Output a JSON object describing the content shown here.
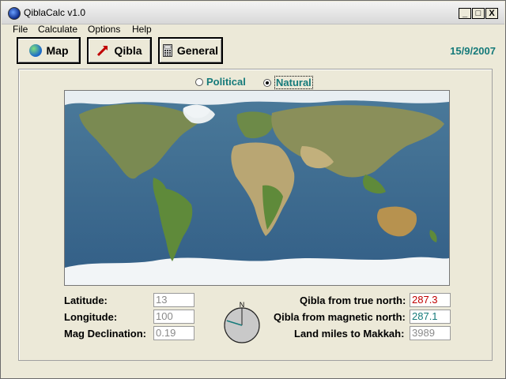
{
  "window": {
    "title": "QiblaCalc v1.0",
    "controls": [
      "_",
      "□",
      "X"
    ]
  },
  "menu": [
    "File",
    "Calculate",
    "Options",
    "Help"
  ],
  "toolbar": {
    "map": "Map",
    "qibla": "Qibla",
    "general": "General"
  },
  "date": "15/9/2007",
  "map_mode": {
    "political": "Political",
    "natural": "Natural",
    "selected": "natural"
  },
  "fields": {
    "latitude": {
      "label": "Latitude:",
      "value": "13"
    },
    "longitude": {
      "label": "Longitude:",
      "value": "100"
    },
    "mag_declination": {
      "label": "Mag Declination:",
      "value": "0.19"
    },
    "qibla_true": {
      "label": "Qibla from true north:",
      "value": "287.3"
    },
    "qibla_magnetic": {
      "label": "Qibla from magnetic north:",
      "value": "287.1"
    },
    "land_miles": {
      "label": "Land miles to Makkah:",
      "value": "3989"
    }
  },
  "compass": {
    "north_label": "N",
    "bearing_deg": 287.3
  },
  "colors": {
    "accent": "#157a7a",
    "qibla_true": "#c00000",
    "qibla_magnetic": "#157a7a"
  },
  "icons": {
    "map": "globe-icon",
    "qibla": "arrow-icon",
    "general": "calculator-icon"
  }
}
